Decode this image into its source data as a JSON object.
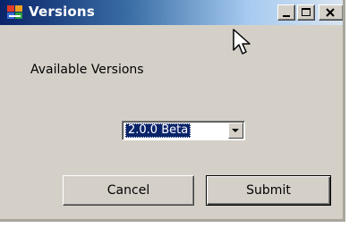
{
  "window": {
    "title": "Versions",
    "controls": {
      "minimize": "minimize",
      "maximize": "maximize",
      "close": "close"
    }
  },
  "main": {
    "label": "Available Versions",
    "version_select": {
      "selected": "2.0.0 Beta"
    }
  },
  "buttons": {
    "cancel": "Cancel",
    "submit": "Submit"
  },
  "colors": {
    "titlebar_start": "#0a246a",
    "titlebar_end": "#d8e4f0",
    "dialog_face": "#d4d0c8",
    "selection": "#0a246a"
  }
}
